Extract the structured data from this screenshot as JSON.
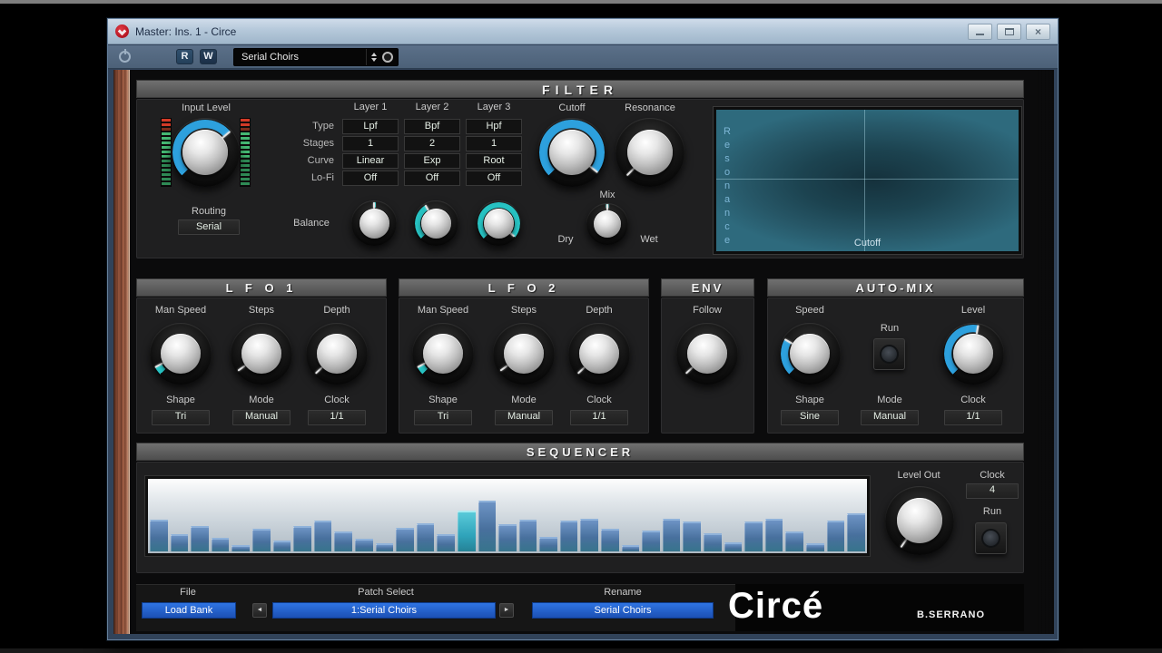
{
  "window": {
    "title": "Master: Ins. 1 - Circe",
    "buttons": {
      "minimize": "minimize",
      "maximize": "maximize",
      "close": "×"
    }
  },
  "toolbar": {
    "read_label": "R",
    "write_label": "W",
    "preset_value": "Serial Choirs"
  },
  "filter": {
    "title": "FILTER",
    "input_level_label": "Input Level",
    "routing_label": "Routing",
    "routing_value": "Serial",
    "balance_label": "Balance",
    "cutoff_label": "Cutoff",
    "resonance_label": "Resonance",
    "mix_label": "Mix",
    "dry_label": "Dry",
    "wet_label": "Wet",
    "layer_table": {
      "headers": [
        "Layer 1",
        "Layer 2",
        "Layer 3"
      ],
      "rows": [
        {
          "label": "Type",
          "values": [
            "Lpf",
            "Bpf",
            "Hpf"
          ]
        },
        {
          "label": "Stages",
          "values": [
            "1",
            "2",
            "1"
          ]
        },
        {
          "label": "Curve",
          "values": [
            "Linear",
            "Exp",
            "Root"
          ]
        },
        {
          "label": "Lo-Fi",
          "values": [
            "Off",
            "Off",
            "Off"
          ]
        }
      ]
    },
    "xy_pad": {
      "y_label": "Resonance",
      "x_label": "Cutoff"
    }
  },
  "lfo1": {
    "title": "L F O 1",
    "knob_labels": [
      "Man Speed",
      "Steps",
      "Depth"
    ],
    "fields": [
      {
        "label": "Shape",
        "value": "Tri"
      },
      {
        "label": "Mode",
        "value": "Manual"
      },
      {
        "label": "Clock",
        "value": "1/1"
      }
    ]
  },
  "lfo2": {
    "title": "L F O 2",
    "knob_labels": [
      "Man Speed",
      "Steps",
      "Depth"
    ],
    "fields": [
      {
        "label": "Shape",
        "value": "Tri"
      },
      {
        "label": "Mode",
        "value": "Manual"
      },
      {
        "label": "Clock",
        "value": "1/1"
      }
    ]
  },
  "env": {
    "title": "ENV",
    "knob_label": "Follow"
  },
  "automix": {
    "title": "AUTO-MIX",
    "speed_label": "Speed",
    "run_label": "Run",
    "level_label": "Level",
    "fields": [
      {
        "label": "Shape",
        "value": "Sine"
      },
      {
        "label": "Mode",
        "value": "Manual"
      },
      {
        "label": "Clock",
        "value": "1/1"
      }
    ]
  },
  "sequencer": {
    "title": "SEQUENCER",
    "level_out_label": "Level Out",
    "clock_label": "Clock",
    "clock_value": "4",
    "run_label": "Run",
    "bars": [
      45,
      24,
      36,
      19,
      9,
      32,
      16,
      36,
      43,
      28,
      18,
      11,
      33,
      40,
      25,
      58,
      72,
      38,
      45,
      21,
      44,
      46,
      32,
      9,
      29,
      46,
      42,
      26,
      13,
      42,
      46,
      28,
      11,
      44,
      54
    ],
    "active_bar": 15
  },
  "footer": {
    "file_label": "File",
    "load_bank_label": "Load Bank",
    "patch_select_label": "Patch Select",
    "patch_value": "1:Serial Choirs",
    "rename_label": "Rename",
    "rename_value": "Serial Choirs",
    "prev_glyph": "◄",
    "next_glyph": "►",
    "logo": "Circé",
    "brand": "B.SERRANO"
  },
  "colors": {
    "arc_blue": "#2da0dd",
    "arc_teal": "#27c2c2",
    "field_blue": "#1c50b4",
    "titlebar": "#b5c8da",
    "wood": "#94543c",
    "seq_bar": "#48709d",
    "seq_bar_active": "#2fa3ba"
  }
}
